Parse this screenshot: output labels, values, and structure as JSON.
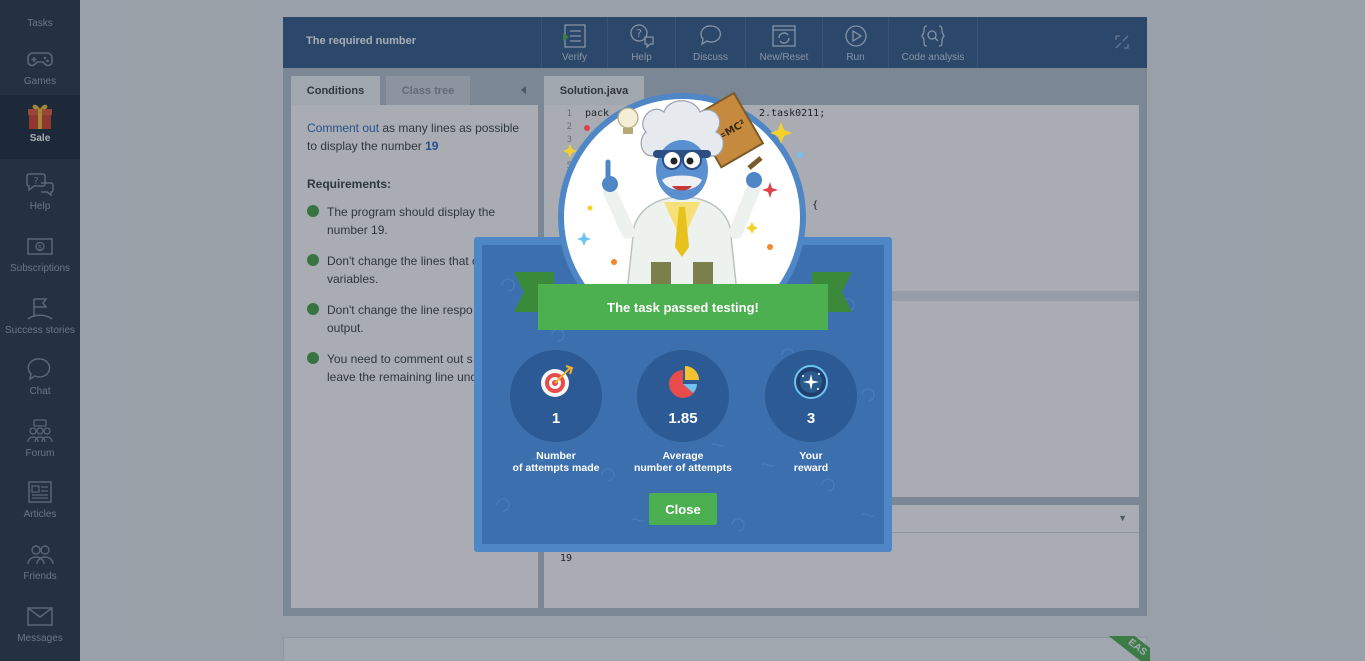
{
  "sidebar": {
    "items": [
      {
        "label": "Tasks",
        "icon": "tasks-icon"
      },
      {
        "label": "Games",
        "icon": "gamepad-icon"
      },
      {
        "label": "Sale",
        "icon": "gift-icon",
        "active": true
      },
      {
        "label": "Help",
        "icon": "help-chat-icon"
      },
      {
        "label": "Subscriptions",
        "icon": "money-icon"
      },
      {
        "label": "Success stories",
        "icon": "flag-icon"
      },
      {
        "label": "Chat",
        "icon": "chat-icon"
      },
      {
        "label": "Forum",
        "icon": "forum-icon"
      },
      {
        "label": "Articles",
        "icon": "articles-icon"
      },
      {
        "label": "Friends",
        "icon": "friends-icon"
      },
      {
        "label": "Messages",
        "icon": "envelope-icon"
      }
    ]
  },
  "editor": {
    "task_title": "The required number",
    "toolbar": [
      {
        "label": "Verify",
        "icon": "verify-icon"
      },
      {
        "label": "Help",
        "icon": "help-icon"
      },
      {
        "label": "Discuss",
        "icon": "discuss-icon"
      },
      {
        "label": "New/Reset",
        "icon": "reset-icon"
      },
      {
        "label": "Run",
        "icon": "run-icon"
      },
      {
        "label": "Code analysis",
        "icon": "code-analysis-icon"
      }
    ],
    "tabs": {
      "conditions": "Conditions",
      "class_tree": "Class tree",
      "file": "Solution.java"
    },
    "conditions": {
      "link": "Comment out",
      "text": " as many lines as possible to display the number ",
      "number": "19",
      "requirements_title": "Requirements:",
      "requirements": [
        "The program should display the number 19.",
        "Don't change the lines that c variables.",
        "Don't change the line respo screen output.",
        "You need to comment out s and leave the remaining line unchanged."
      ]
    },
    "code_lines": [
      {
        "num": "1",
        "text": "pack"
      },
      {
        "num": "2",
        "text": ""
      },
      {
        "num": "3",
        "text": "/*"
      },
      {
        "num": "5",
        "text": ""
      },
      {
        "num": "6",
        "text": ""
      }
    ],
    "code_fragments": {
      "package_tail": "2.task0211;",
      "main_tail": "] args) {"
    },
    "output": "19"
  },
  "modal": {
    "banner": "The task passed testing!",
    "badge": "E=MC²",
    "stats": [
      {
        "value": "1",
        "label_line1": "Number",
        "label_line2": "of attempts made",
        "icon": "target-icon"
      },
      {
        "value": "1.85",
        "label_line1": "Average",
        "label_line2": "number of attempts",
        "icon": "pie-chart-icon"
      },
      {
        "value": "3",
        "label_line1": "Your",
        "label_line2": "reward",
        "icon": "galaxy-icon"
      }
    ],
    "close_label": "Close"
  },
  "corner_ribbon": "EAS",
  "colors": {
    "sidebar_bg": "#27374b",
    "toolbar_bg": "#345c8c",
    "modal_border": "#4e86c6",
    "modal_bg": "#3b6fad",
    "banner_green": "#4caf50",
    "close_green": "#4caf50",
    "link_blue": "#2a6bbf"
  }
}
